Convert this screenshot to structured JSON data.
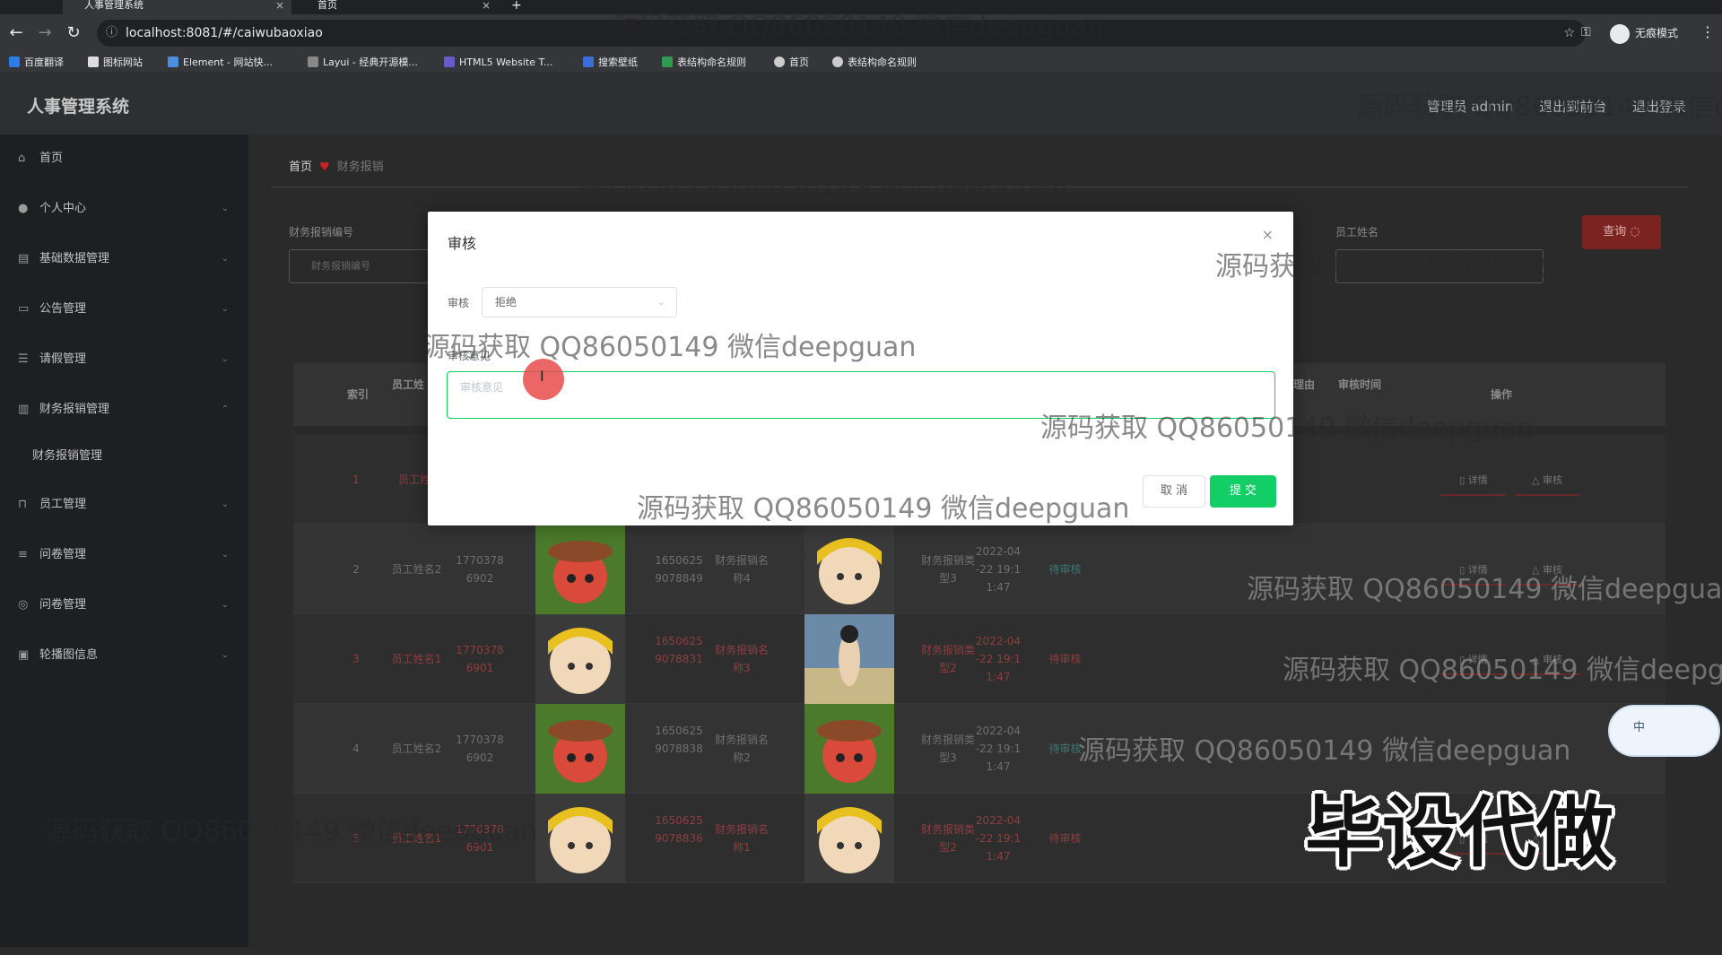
{
  "browser": {
    "tabs": [
      {
        "title": "人事管理系统",
        "active": true
      },
      {
        "title": "首页",
        "active": false
      }
    ],
    "url": "localhost:8081/#/caiwubaoxiao",
    "incognito_label": "无痕模式",
    "bookmarks": [
      "百度翻译",
      "图标网站",
      "Element - 网站快...",
      "Layui - 经典开源模...",
      "HTML5 Website T...",
      "搜索壁纸",
      "表结构命名规则",
      "首页",
      "表结构命名规则"
    ]
  },
  "app": {
    "title": "人事管理系统",
    "header_links": [
      "管理员 admin",
      "退出到前台",
      "退出登录"
    ]
  },
  "sidebar": {
    "items": [
      {
        "label": "首页",
        "icon": "home-icon",
        "has_arrow": false
      },
      {
        "label": "个人中心",
        "icon": "user-icon",
        "has_arrow": true
      },
      {
        "label": "基础数据管理",
        "icon": "data-icon",
        "has_arrow": true
      },
      {
        "label": "公告管理",
        "icon": "notice-icon",
        "has_arrow": true
      },
      {
        "label": "请假管理",
        "icon": "list-icon",
        "has_arrow": true
      },
      {
        "label": "财务报销管理",
        "icon": "chart-icon",
        "has_arrow": true,
        "expanded": true
      },
      {
        "label": "财务报销管理",
        "icon": "",
        "has_arrow": false,
        "sub": true
      },
      {
        "label": "员工管理",
        "icon": "staff-icon",
        "has_arrow": true
      },
      {
        "label": "问卷管理",
        "icon": "survey-icon",
        "has_arrow": true
      },
      {
        "label": "问卷管理",
        "icon": "survey2-icon",
        "has_arrow": true
      },
      {
        "label": "轮播图信息",
        "icon": "image-icon",
        "has_arrow": true
      }
    ]
  },
  "breadcrumb": {
    "home": "首页",
    "current": "财务报销"
  },
  "search": {
    "field1_label": "财务报销编号",
    "field1_placeholder": "财务报销编号",
    "field2_label": "员工姓名",
    "query_button": "查询"
  },
  "table": {
    "headers": {
      "index": "索引",
      "name": "员工姓",
      "reason": "理由",
      "audit_time": "审核时间",
      "ops": "操作"
    },
    "rows": [
      {
        "index": "1",
        "name": "员工姓",
        "tone": "red",
        "ops": [
          "详情",
          "审核"
        ]
      },
      {
        "index": "2",
        "name": "员工姓名2",
        "phone": "17703786902",
        "code": "16506259078849",
        "title": "财务报销名称4",
        "type": "财务报销类型3",
        "time": "2022-04-22 19:11:47",
        "status": "待审核",
        "tone": "gray",
        "ops": [
          "详情",
          "审核"
        ]
      },
      {
        "index": "3",
        "name": "员工姓名1",
        "phone": "17703786901",
        "code": "16506259078831",
        "title": "财务报销名称3",
        "type": "财务报销类型2",
        "time": "2022-04-22 19:11:47",
        "status": "待审核",
        "tone": "red",
        "ops": [
          "详情",
          "审核"
        ]
      },
      {
        "index": "4",
        "name": "员工姓名2",
        "phone": "17703786902",
        "code": "16506259078838",
        "title": "财务报销名称2",
        "type": "财务报销类型3",
        "time": "2022-04-22 19:11:47",
        "status": "待审核",
        "tone": "gray",
        "ops": []
      },
      {
        "index": "5",
        "name": "员工姓名1",
        "phone": "17703786901",
        "code": "16506259078836",
        "title": "财务报销名称1",
        "type": "财务报销类型2",
        "time": "2022-04-22 19:11:47",
        "status": "待审核",
        "tone": "red",
        "ops": [
          "详情",
          "审核"
        ]
      }
    ]
  },
  "modal": {
    "title": "审核",
    "audit_label": "审核",
    "audit_value": "拒绝",
    "opinion_label": "审核意见",
    "opinion_placeholder": "审核意见",
    "cancel": "取 消",
    "submit": "提 交"
  },
  "overlays": {
    "watermark": "源码获取 QQ86050149 微信deepguan",
    "banner": "毕设代做",
    "ime_label": "中"
  },
  "colors": {
    "accent": "#13ce66",
    "danger": "#7a2320"
  }
}
